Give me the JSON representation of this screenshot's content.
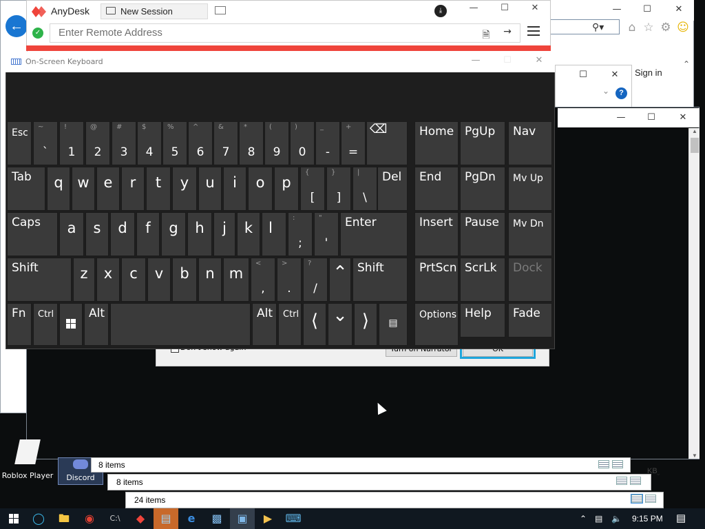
{
  "anydesk": {
    "app_name": "AnyDesk",
    "tab_label": "New Session",
    "address_placeholder": "Enter Remote Address"
  },
  "browser": {
    "sign_in": "Sign in"
  },
  "osk": {
    "title": "On-Screen Keyboard",
    "row1": [
      {
        "label": "Esc"
      },
      {
        "shift": "~",
        "main": "`"
      },
      {
        "shift": "!",
        "main": "1"
      },
      {
        "shift": "@",
        "main": "2"
      },
      {
        "shift": "#",
        "main": "3"
      },
      {
        "shift": "$",
        "main": "4"
      },
      {
        "shift": "%",
        "main": "5"
      },
      {
        "shift": "^",
        "main": "6"
      },
      {
        "shift": "&",
        "main": "7"
      },
      {
        "shift": "*",
        "main": "8"
      },
      {
        "shift": "(",
        "main": "9"
      },
      {
        "shift": ")",
        "main": "0"
      },
      {
        "shift": "_",
        "main": "-"
      },
      {
        "shift": "+",
        "main": "="
      }
    ],
    "row2": [
      {
        "label": "Tab"
      },
      {
        "label": "q"
      },
      {
        "label": "w"
      },
      {
        "label": "e"
      },
      {
        "label": "r"
      },
      {
        "label": "t"
      },
      {
        "label": "y"
      },
      {
        "label": "u"
      },
      {
        "label": "i"
      },
      {
        "label": "o"
      },
      {
        "label": "p"
      },
      {
        "shift": "{",
        "main": "["
      },
      {
        "shift": "}",
        "main": "]"
      },
      {
        "shift": "|",
        "main": "\\"
      },
      {
        "label": "Del"
      }
    ],
    "row3": [
      {
        "label": "Caps"
      },
      {
        "label": "a"
      },
      {
        "label": "s"
      },
      {
        "label": "d"
      },
      {
        "label": "f"
      },
      {
        "label": "g"
      },
      {
        "label": "h"
      },
      {
        "label": "j"
      },
      {
        "label": "k"
      },
      {
        "label": "l"
      },
      {
        "shift": ":",
        "main": ";"
      },
      {
        "shift": "\"",
        "main": "'"
      },
      {
        "label": "Enter"
      }
    ],
    "row4": [
      {
        "label": "Shift"
      },
      {
        "label": "z"
      },
      {
        "label": "x"
      },
      {
        "label": "c"
      },
      {
        "label": "v"
      },
      {
        "label": "b"
      },
      {
        "label": "n"
      },
      {
        "label": "m"
      },
      {
        "shift": "<",
        "main": ","
      },
      {
        "shift": ">",
        "main": "."
      },
      {
        "shift": "?",
        "main": "/"
      },
      {
        "label": "Shift"
      }
    ],
    "row5": [
      {
        "label": "Fn"
      },
      {
        "label": "Ctrl"
      },
      {
        "label": "Alt"
      },
      {
        "label": "Alt"
      },
      {
        "label": "Ctrl"
      }
    ],
    "nav_keys": {
      "home": "Home",
      "pgup": "PgUp",
      "nav": "Nav",
      "end": "End",
      "pgdn": "PgDn",
      "mvup": "Mv Up",
      "insert": "Insert",
      "pause": "Pause",
      "mvdn": "Mv Dn",
      "prtscn": "PrtScn",
      "scrlk": "ScrLk",
      "dock": "Dock",
      "options": "Options",
      "help": "Help",
      "fade": "Fade"
    }
  },
  "narrator": {
    "dont_show": "Don't show again",
    "turn_on": "Turn on Narrator",
    "ok": "OK"
  },
  "desktop": {
    "icon1": "Roblox",
    "icon2": "Roblox Player",
    "icon3": "Discord"
  },
  "explorer": {
    "status1": "8 items",
    "status2": "8 items",
    "status3": "24 items",
    "size_fragment": "KB"
  },
  "taskbar": {
    "time": "9:15 PM"
  },
  "colors": {
    "anydesk_red": "#ef443b",
    "highlight": "#1ea5db",
    "osk_key": "#3a3a3a"
  }
}
